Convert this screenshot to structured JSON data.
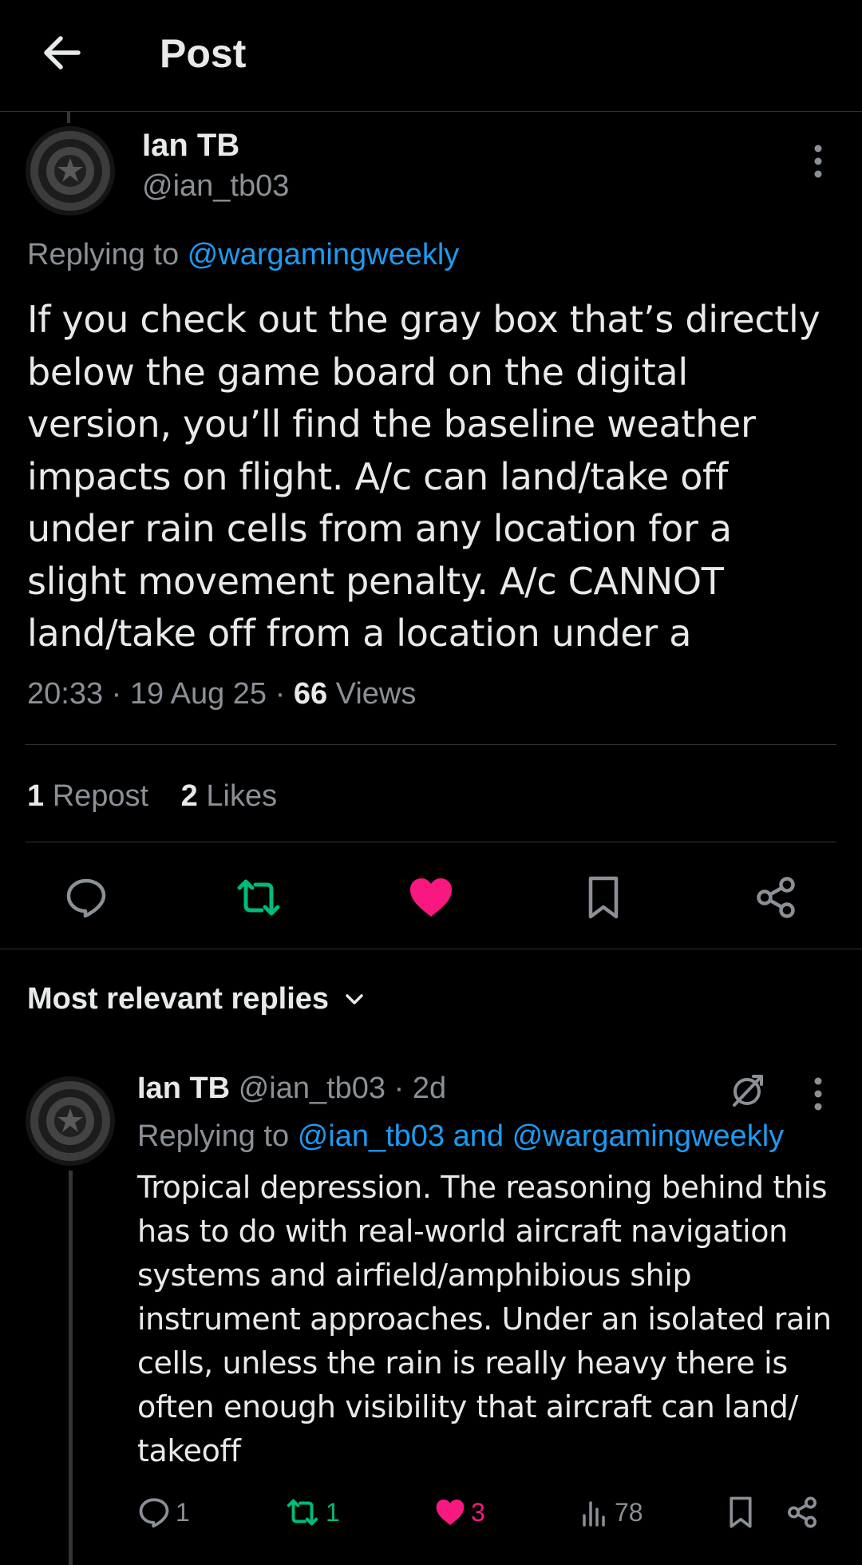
{
  "header": {
    "title": "Post"
  },
  "post": {
    "author_name": "Ian TB",
    "author_handle": "@ian_tb03",
    "replying_prefix": "Replying to",
    "replying_to": "@wargamingweekly",
    "text": "If you check out the gray box that’s directly below the game board on the digital version, you’ll find the baseline weather impacts on flight. A/c can land/take off under rain cells from any location for a slight movement penalty. A/c CANNOT land/take off from a location under a",
    "time": "20:33",
    "date": "19 Aug 25",
    "views_count": "66",
    "views_label": "Views",
    "reposts_count": "1",
    "reposts_label": "Repost",
    "likes_count": "2",
    "likes_label": "Likes"
  },
  "replies_section": {
    "title": "Most relevant replies"
  },
  "reply": {
    "author_name": "Ian TB",
    "author_handle": "@ian_tb03",
    "age": "2d",
    "replying_prefix": "Replying to",
    "replying_to": "@ian_tb03 and @wargamingweekly",
    "text": "Tropical depression. The reasoning behind this has to do with real-world aircraft navigation systems and airfield/amphibious ship instrument approaches. Under an isolated rain cells, unless the rain is really heavy there is often enough visibility that aircraft can land/ takeoff",
    "replies_count": "1",
    "reposts_count": "1",
    "likes_count": "3",
    "views_count": "78"
  },
  "colors": {
    "background": "#000000",
    "text_primary": "#e7e9ea",
    "text_secondary": "#8b9096",
    "link": "#1d9bf0",
    "repost_active": "#00ba7c",
    "like_active": "#f91880",
    "divider": "#2f3336"
  },
  "icons": [
    "back-arrow-icon",
    "more-vertical-icon",
    "reply-icon",
    "repost-icon",
    "like-icon",
    "bookmark-icon",
    "share-icon",
    "chevron-down-icon",
    "grok-icon",
    "views-icon"
  ]
}
